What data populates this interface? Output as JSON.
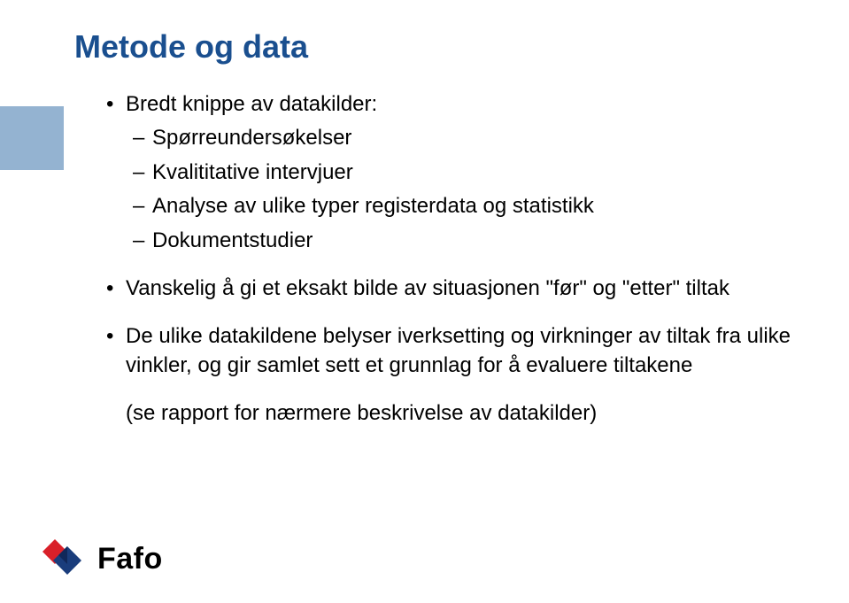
{
  "title": "Metode og data",
  "bullets": {
    "b1": {
      "text": "Bredt knippe av datakilder:",
      "sub": {
        "s1": "Spørreundersøkelser",
        "s2": "Kvalititative intervjuer",
        "s3": "Analyse av ulike typer registerdata og statistikk",
        "s4": "Dokumentstudier"
      }
    },
    "b2": "Vanskelig å gi et eksakt bilde av situasjonen \"før\" og \"etter\" tiltak",
    "b3": "De ulike datakildene belyser iverksetting og virkninger av tiltak fra ulike vinkler, og gir samlet sett et grunnlag for å evaluere tiltakene"
  },
  "footnote": "(se rapport for nærmere beskrivelse av datakilder)",
  "logo": {
    "text": "Fafo"
  },
  "colors": {
    "titleColor": "#1a4f8f",
    "decoBlue": "#94b3d1",
    "logoRed": "#d92029",
    "logoBlue": "#1a3d7c"
  }
}
